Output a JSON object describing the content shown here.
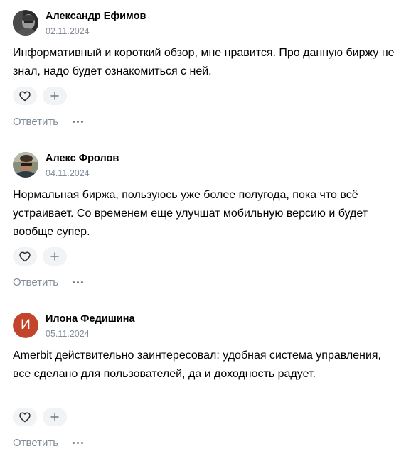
{
  "comments": [
    {
      "author": "Александр Ефимов",
      "date": "02.11.2024",
      "text": "Информативный и короткий обзор, мне нравится. Про данную биржу не знал, надо будет ознакомиться с ней.",
      "avatar": {
        "type": "photo",
        "icon": "user-photo-bw"
      },
      "reply_label": "Ответить"
    },
    {
      "author": "Алекс Фролов",
      "date": "04.11.2024",
      "text": "Нормальная биржа, пользуюсь уже более полугода, пока что всё устраивает. Со временем еще улучшат мобильную версию и будет вообще супер.",
      "avatar": {
        "type": "photo",
        "icon": "user-photo-color"
      },
      "reply_label": "Ответить"
    },
    {
      "author": "Илона Федишина",
      "date": "05.11.2024",
      "text": "Amerbit действительно заинтересовал: удобная система управления, все сделано для пользователей, да и доходность радует.",
      "avatar": {
        "type": "letter",
        "letter": "И",
        "color": "#c2442a"
      },
      "reply_label": "Ответить"
    }
  ],
  "icons": {
    "like": "heart-icon",
    "add_reaction": "plus-icon",
    "more": "more-dots-icon"
  },
  "colors": {
    "muted_text": "#818c99",
    "button_bg": "#f2f3f5",
    "divider": "#e7e8ec"
  }
}
